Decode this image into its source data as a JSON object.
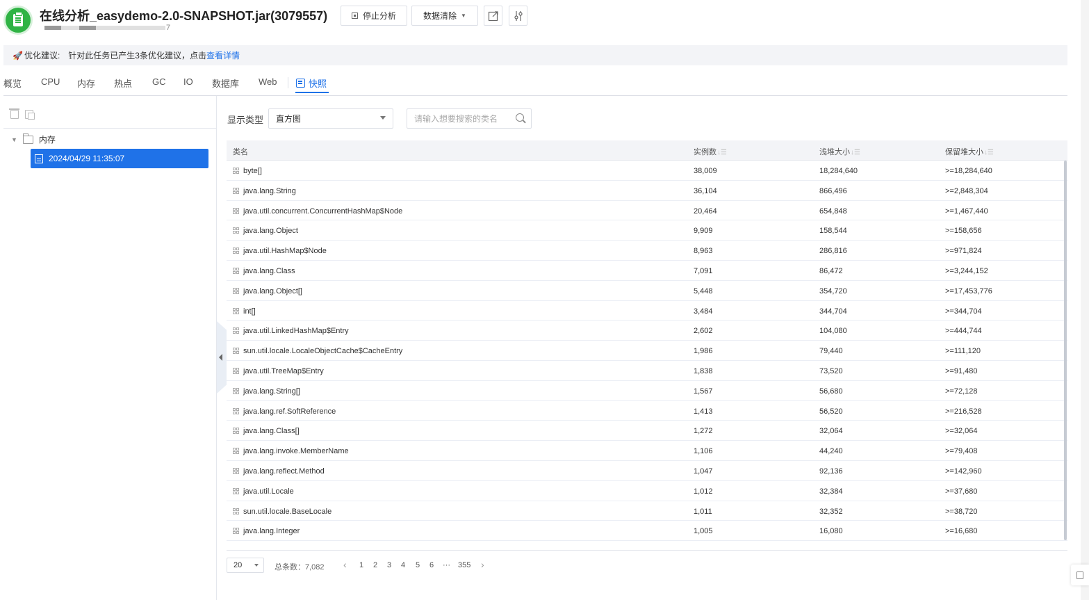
{
  "header": {
    "title": "在线分析_easydemo-2.0-SNAPSHOT.jar(3079557)",
    "subtitle_tail": "7",
    "buttons": {
      "stop": "停止分析",
      "clear": "数据清除"
    }
  },
  "advice": {
    "label": "优化建议:",
    "message": "针对此任务已产生3条优化建议，点击",
    "link": "查看详情"
  },
  "tabs": [
    {
      "label": "概览"
    },
    {
      "label": "CPU"
    },
    {
      "label": "内存"
    },
    {
      "label": "热点"
    },
    {
      "label": "GC"
    },
    {
      "label": "IO"
    },
    {
      "label": "数据库"
    },
    {
      "label": "Web"
    },
    {
      "label": "快照"
    }
  ],
  "tree": {
    "root": "内存",
    "item": "2024/04/29 11:35:07"
  },
  "filter": {
    "display_type_label": "显示类型",
    "display_type_value": "直方图",
    "search_placeholder": "请输入想要搜索的类名"
  },
  "table": {
    "headers": [
      "类名",
      "实例数",
      "浅堆大小",
      "保留堆大小"
    ],
    "rows": [
      {
        "name": "byte[]",
        "instances": "38,009",
        "shallow": "18,284,640",
        "retained": ">=18,284,640"
      },
      {
        "name": "java.lang.String",
        "instances": "36,104",
        "shallow": "866,496",
        "retained": ">=2,848,304"
      },
      {
        "name": "java.util.concurrent.ConcurrentHashMap$Node",
        "instances": "20,464",
        "shallow": "654,848",
        "retained": ">=1,467,440"
      },
      {
        "name": "java.lang.Object",
        "instances": "9,909",
        "shallow": "158,544",
        "retained": ">=158,656"
      },
      {
        "name": "java.util.HashMap$Node",
        "instances": "8,963",
        "shallow": "286,816",
        "retained": ">=971,824"
      },
      {
        "name": "java.lang.Class",
        "instances": "7,091",
        "shallow": "86,472",
        "retained": ">=3,244,152"
      },
      {
        "name": "java.lang.Object[]",
        "instances": "5,448",
        "shallow": "354,720",
        "retained": ">=17,453,776"
      },
      {
        "name": "int[]",
        "instances": "3,484",
        "shallow": "344,704",
        "retained": ">=344,704"
      },
      {
        "name": "java.util.LinkedHashMap$Entry",
        "instances": "2,602",
        "shallow": "104,080",
        "retained": ">=444,744"
      },
      {
        "name": "sun.util.locale.LocaleObjectCache$CacheEntry",
        "instances": "1,986",
        "shallow": "79,440",
        "retained": ">=111,120"
      },
      {
        "name": "java.util.TreeMap$Entry",
        "instances": "1,838",
        "shallow": "73,520",
        "retained": ">=91,480"
      },
      {
        "name": "java.lang.String[]",
        "instances": "1,567",
        "shallow": "56,680",
        "retained": ">=72,128"
      },
      {
        "name": "java.lang.ref.SoftReference",
        "instances": "1,413",
        "shallow": "56,520",
        "retained": ">=216,528"
      },
      {
        "name": "java.lang.Class[]",
        "instances": "1,272",
        "shallow": "32,064",
        "retained": ">=32,064"
      },
      {
        "name": "java.lang.invoke.MemberName",
        "instances": "1,106",
        "shallow": "44,240",
        "retained": ">=79,408"
      },
      {
        "name": "java.lang.reflect.Method",
        "instances": "1,047",
        "shallow": "92,136",
        "retained": ">=142,960"
      },
      {
        "name": "java.util.Locale",
        "instances": "1,012",
        "shallow": "32,384",
        "retained": ">=37,680"
      },
      {
        "name": "sun.util.locale.BaseLocale",
        "instances": "1,011",
        "shallow": "32,352",
        "retained": ">=38,720"
      },
      {
        "name": "java.lang.Integer",
        "instances": "1,005",
        "shallow": "16,080",
        "retained": ">=16,680"
      }
    ]
  },
  "pagination": {
    "page_size": "20",
    "total": "总条数：7,082",
    "pages": [
      "1",
      "2",
      "3",
      "4",
      "5",
      "6",
      "···",
      "355"
    ]
  }
}
